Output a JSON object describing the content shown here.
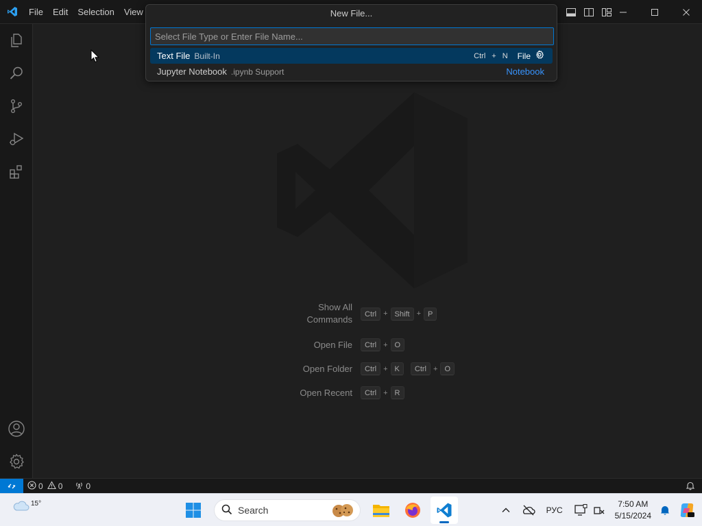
{
  "titlebar": {
    "logo_icon": "vscode-logo-icon",
    "menu": [
      "File",
      "Edit",
      "Selection",
      "View"
    ],
    "layout_icons": [
      "toggle-primary-sidebar-icon",
      "toggle-panel-icon",
      "toggle-secondary-sidebar-icon",
      "customize-layout-icon"
    ],
    "window_controls": [
      "minimize-icon",
      "maximize-icon",
      "close-icon"
    ]
  },
  "activitybar": {
    "top": [
      "explorer-icon",
      "search-icon",
      "source-control-icon",
      "run-debug-icon",
      "extensions-icon"
    ],
    "bottom": [
      "accounts-icon",
      "manage-gear-icon"
    ]
  },
  "quickpick": {
    "title": "New File...",
    "placeholder": "Select File Type or Enter File Name...",
    "items": [
      {
        "label": "Text File",
        "description": "Built-In",
        "keys": [
          "Ctrl",
          "N"
        ],
        "detail": "File",
        "detail_icon": "gear-icon",
        "active": true
      },
      {
        "label": "Jupyter Notebook",
        "description": ".ipynb Support",
        "link": "Notebook",
        "active": false
      }
    ]
  },
  "shortcuts": [
    {
      "label": [
        "Show All",
        "Commands"
      ],
      "keys": [
        [
          "Ctrl",
          "Shift",
          "P"
        ]
      ]
    },
    {
      "label": [
        "Open File"
      ],
      "keys": [
        [
          "Ctrl",
          "O"
        ]
      ]
    },
    {
      "label": [
        "Open Folder"
      ],
      "keys": [
        [
          "Ctrl",
          "K"
        ],
        [
          "Ctrl",
          "O"
        ]
      ]
    },
    {
      "label": [
        "Open Recent"
      ],
      "keys": [
        [
          "Ctrl",
          "R"
        ]
      ]
    }
  ],
  "statusbar": {
    "remote_icon": "remote-indicator-icon",
    "errors": "0",
    "warnings": "0",
    "ports": "0",
    "bell_icon": "notifications-bell-icon"
  },
  "taskbar": {
    "weather_temp": "15°",
    "search_label": "Search",
    "language": "РУС",
    "time": "7:50 AM",
    "date": "5/15/2024"
  },
  "colors": {
    "accent": "#0078d4",
    "link": "#3794ff",
    "selection": "#04395e",
    "editor_bg": "#1f1f1f",
    "chrome_bg": "#181818"
  }
}
